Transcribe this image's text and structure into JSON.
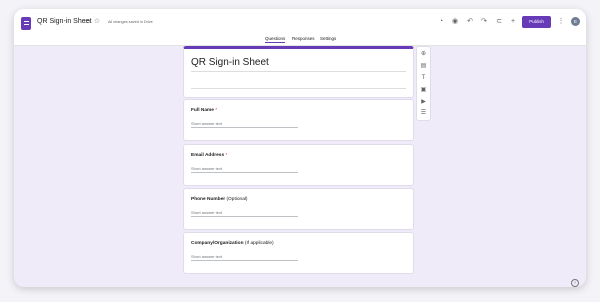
{
  "header": {
    "doc_title": "QR Sign-in Sheet",
    "save_status": "All changes saved in Drive",
    "publish_label": "Publish",
    "avatar_initial": "E"
  },
  "tabs": [
    {
      "label": "Questions",
      "active": true
    },
    {
      "label": "Responses",
      "active": false
    },
    {
      "label": "Settings",
      "active": false
    }
  ],
  "form": {
    "title": "QR Sign-in Sheet"
  },
  "questions": [
    {
      "title": "Full Name",
      "suffix": "",
      "required": true,
      "placeholder": "Short answer text"
    },
    {
      "title": "Email Address",
      "suffix": "",
      "required": true,
      "placeholder": "Short answer text"
    },
    {
      "title": "Phone Number",
      "suffix": " (Optional)",
      "required": false,
      "placeholder": "Short answer text"
    },
    {
      "title": "Company/Organization",
      "suffix": " (If applicable)",
      "required": false,
      "placeholder": "Short answer text"
    }
  ],
  "colors": {
    "accent": "#673ab7",
    "background": "#f0ebf8"
  }
}
